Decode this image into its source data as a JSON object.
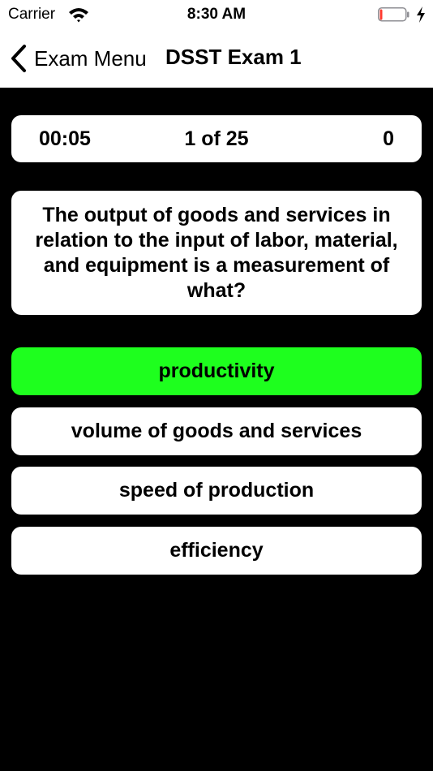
{
  "status_bar": {
    "carrier": "Carrier",
    "time": "8:30 AM",
    "battery_level": 0.08,
    "battery_color": "#ff3b30",
    "charging": true
  },
  "nav": {
    "back_label": "Exam Menu",
    "title": "DSST Exam 1"
  },
  "stats": {
    "timer": "00:05",
    "progress": "1 of 25",
    "score": "0"
  },
  "question": {
    "text": "The output of goods and services in relation to the input of labor, material, and equipment is a measurement of what?"
  },
  "answers": [
    {
      "label": "productivity",
      "state": "correct"
    },
    {
      "label": "volume of goods and services",
      "state": "default"
    },
    {
      "label": "speed of production",
      "state": "default"
    },
    {
      "label": "efficiency",
      "state": "default"
    }
  ],
  "colors": {
    "background": "#000000",
    "card": "#ffffff",
    "correct": "#1eff1e"
  }
}
